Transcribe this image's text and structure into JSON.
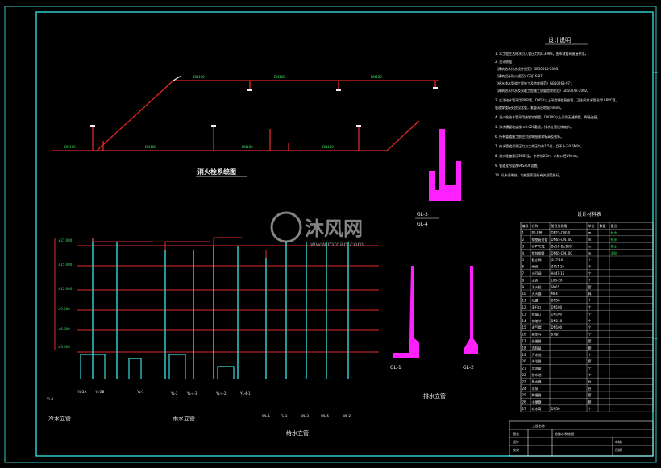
{
  "colors": {
    "bg": "#000000",
    "frame": "#2fc8c8",
    "pipe_red": "#e02828",
    "pipe_cyan": "#38d8d8",
    "green": "#40e060",
    "magenta": "#ff20ff",
    "white": "#f0f0f0",
    "yellow": "#e8e840"
  },
  "labels": {
    "fire_title": "消火栓系统图",
    "design_notes_title": "设计说明",
    "materials_title": "设计材料表",
    "drain_riser": "排水立管",
    "rain_riser": "雨水立管",
    "supply_riser": "给水立管",
    "cold_riser": "冷水立管",
    "gl3": "GL-3",
    "gl4": "GL-4",
    "gl1": "GL-1",
    "gl2": "GL-2",
    "watermark_brand": "沐风网",
    "watermark_url": "www.mfcad.com"
  },
  "notes": [
    "1. 本工程生活给水引入管压力为0.3MPa，由市政管网直接供水。",
    "2. 设计依据：",
    "   《建筑给水排水设计规范》GB50015-2003；",
    "   《建筑设计防火规范》GBJ16-87；",
    "   《给水排水管道工程施工及验收规范》GB50268-97；",
    "   《建筑给水排水及采暖工程施工质量验收规范》GB50242-2002。",
    "3. 生活给水管采用PP-R管，DN50以上采用钢塑复合管，卫生间排水管采用U-PVC管。",
    "   管道穿楼板处应设套管，套管高出地面50mm。",
    "4. 消火栓给水管采用热镀锌钢管，DN100以上采用无缝钢管，焊接连接。",
    "5. 排水横管坡度按i=0.026敷设，排水立管设伸缩节。",
    "6. 所有管道施工前应对建筑图核对标高及坐标。",
    "7. 给水管道试验压力为工作压力的1.5倍，且不小于0.6MPa。",
    "8. 消火栓箱采用SN65型，水带长25m，水枪口径19mm。",
    "9. 管道支吊架按96S406设置。",
    "10. 凡未说明处，均按国家现行有关规范执行。"
  ],
  "materials_headers": [
    "编号",
    "名称",
    "型号及规格",
    "单位",
    "数量",
    "备注"
  ],
  "materials_rows": [
    [
      "1",
      "PP-R管",
      "DN15-DN50",
      "m",
      "",
      "给水"
    ],
    [
      "2",
      "钢塑复合管",
      "DN65-DN100",
      "m",
      "",
      "给水"
    ],
    [
      "3",
      "U-PVC管",
      "De50-De160",
      "m",
      "",
      "排水"
    ],
    [
      "4",
      "镀锌钢管",
      "DN65-DN100",
      "m",
      "",
      "消防"
    ],
    [
      "5",
      "截止阀",
      "J11T-16",
      "个",
      "",
      ""
    ],
    [
      "6",
      "闸阀",
      "Z41T-16",
      "个",
      "",
      ""
    ],
    [
      "7",
      "止回阀",
      "H44T-16",
      "个",
      "",
      ""
    ],
    [
      "8",
      "水表",
      "LXS-20",
      "个",
      "",
      ""
    ],
    [
      "9",
      "消火栓",
      "SN65",
      "套",
      "",
      ""
    ],
    [
      "10",
      "灭火器",
      "MF4",
      "具",
      "",
      ""
    ],
    [
      "11",
      "地漏",
      "DN50",
      "个",
      "",
      ""
    ],
    [
      "12",
      "清扫口",
      "DN100",
      "个",
      "",
      ""
    ],
    [
      "13",
      "检查口",
      "DN100",
      "个",
      "",
      ""
    ],
    [
      "14",
      "伸缩节",
      "DN110",
      "个",
      "",
      ""
    ],
    [
      "15",
      "通气帽",
      "DN100",
      "个",
      "",
      ""
    ],
    [
      "16",
      "雨水斗",
      "87型",
      "个",
      "",
      ""
    ],
    [
      "17",
      "坐便器",
      "",
      "套",
      "",
      ""
    ],
    [
      "18",
      "洗脸盆",
      "",
      "套",
      "",
      ""
    ],
    [
      "19",
      "污水池",
      "",
      "个",
      "",
      ""
    ],
    [
      "20",
      "淋浴器",
      "",
      "套",
      "",
      ""
    ],
    [
      "21",
      "洗涤盆",
      "",
      "个",
      "",
      ""
    ],
    [
      "22",
      "拖布池",
      "",
      "个",
      "",
      ""
    ],
    [
      "23",
      "热水器",
      "",
      "台",
      "",
      ""
    ],
    [
      "24",
      "水泵",
      "",
      "台",
      "",
      ""
    ],
    [
      "25",
      "蹲便器",
      "",
      "套",
      "",
      ""
    ],
    [
      "26",
      "小便器",
      "",
      "套",
      "",
      ""
    ],
    [
      "27",
      "存水弯",
      "DN50",
      "个",
      "",
      ""
    ]
  ],
  "rain_riser_tags": [
    "YL-2A",
    "YL-2B",
    "YL-1",
    "YL-2",
    "YL-4-3",
    "YL-4-2",
    "YL-4-1"
  ],
  "supply_riser_tags": [
    "WL-1",
    "FL-1",
    "WL-3",
    "WL-5",
    "WL-2"
  ],
  "drain_riser_tags": [
    "YL-1"
  ],
  "title_block": [
    "工程名称",
    "图名",
    "给排水系统图",
    "设计",
    "校对",
    "审核",
    "日期"
  ]
}
